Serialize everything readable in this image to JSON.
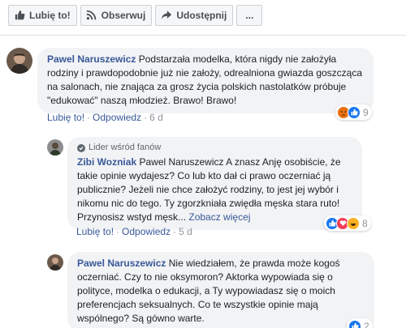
{
  "toolbar": {
    "like_label": "Lubię to!",
    "follow_label": "Obserwuj",
    "share_label": "Udostępnij",
    "more_label": "..."
  },
  "comments": [
    {
      "author": "Pawel Naruszewicz",
      "text": "Podstarzała modelka, która nigdy nie założyła rodziny i prawdopodobnie już nie założy, odrealniona gwiazda goszcząca na salonach, nie znająca za grosz życia polskich nastolatków próbuje \"edukować\" naszą młodzież. Brawo! Brawo!",
      "like_action": "Lubię to!",
      "reply_action": "Odpowiedz",
      "time": "6 d",
      "reaction_count": "9",
      "reactions": [
        "angry-icon",
        "like-icon"
      ]
    },
    {
      "badge": "Lider wśród fanów",
      "author": "Zibi Wozniak",
      "text": "Pawel Naruszewicz A znasz Anję osobiście, że takie opinie wydajesz? Co lub kto dał ci prawo oczerniać ją publicznie? Jeżeli nie chce założyć rodziny, to jest jej wybór i nikomu nic do tego. Ty zgorzkniała zwiędła męska stara ruto! Przynosisz wstyd męsk...",
      "see_more": "Zobacz więcej",
      "like_action": "Lubię to!",
      "reply_action": "Odpowiedz",
      "time": "5 d",
      "reaction_count": "8",
      "reactions": [
        "like-icon",
        "love-icon",
        "haha-icon"
      ]
    },
    {
      "author": "Pawel Naruszewicz",
      "text": "Nie wiedziałem, że prawda może kogoś oczerniać. Czy to nie oksymoron? Aktorka wypowiada się o polityce, modelka o edukacji, a Ty wypowiadasz się o moich preferencjach seksualnych. Co te wszystkie opinie mają wspólnego? Są gówno warte.",
      "reaction_count": "2",
      "reactions": [
        "like-icon"
      ]
    }
  ],
  "colors": {
    "link": "#385898",
    "bubble": "#f2f3f5",
    "like": "#1877f2",
    "love": "#f33e58",
    "angry": "#e9710f",
    "haha": "#f7b125"
  }
}
